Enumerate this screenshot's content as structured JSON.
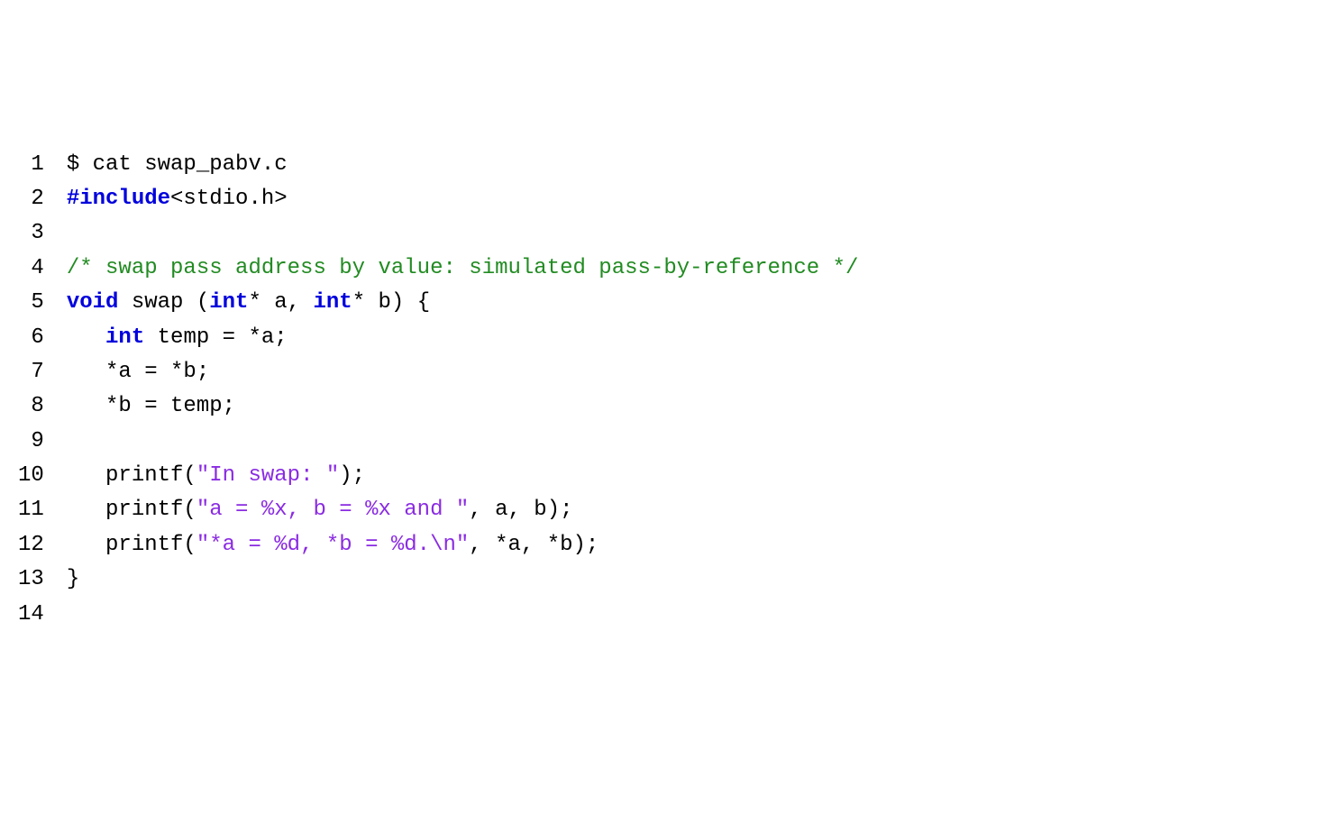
{
  "lines": [
    {
      "n": "1",
      "tokens": [
        {
          "cls": "black",
          "t": "$ cat swap_pabv.c"
        }
      ]
    },
    {
      "n": "2",
      "tokens": [
        {
          "cls": "preproc",
          "t": "#include"
        },
        {
          "cls": "black",
          "t": "<stdio.h>"
        }
      ]
    },
    {
      "n": "3",
      "tokens": []
    },
    {
      "n": "4",
      "tokens": [
        {
          "cls": "comment",
          "t": "/* swap pass address by value: simulated pass-by-reference */"
        }
      ]
    },
    {
      "n": "5",
      "tokens": [
        {
          "cls": "keyword",
          "t": "void"
        },
        {
          "cls": "black",
          "t": " swap ("
        },
        {
          "cls": "keyword",
          "t": "int"
        },
        {
          "cls": "black",
          "t": "* a, "
        },
        {
          "cls": "keyword",
          "t": "int"
        },
        {
          "cls": "black",
          "t": "* b) {"
        }
      ]
    },
    {
      "n": "6",
      "tokens": [
        {
          "cls": "black",
          "t": "   "
        },
        {
          "cls": "keyword",
          "t": "int"
        },
        {
          "cls": "black",
          "t": " temp = *a;"
        }
      ]
    },
    {
      "n": "7",
      "tokens": [
        {
          "cls": "black",
          "t": "   *a = *b;"
        }
      ]
    },
    {
      "n": "8",
      "tokens": [
        {
          "cls": "black",
          "t": "   *b = temp;"
        }
      ]
    },
    {
      "n": "9",
      "tokens": []
    },
    {
      "n": "10",
      "tokens": [
        {
          "cls": "black",
          "t": "   printf("
        },
        {
          "cls": "string",
          "t": "\"In swap: \""
        },
        {
          "cls": "black",
          "t": ");"
        }
      ]
    },
    {
      "n": "11",
      "tokens": [
        {
          "cls": "black",
          "t": "   printf("
        },
        {
          "cls": "string",
          "t": "\"a = %x, b = %x and \""
        },
        {
          "cls": "black",
          "t": ", a, b);"
        }
      ]
    },
    {
      "n": "12",
      "tokens": [
        {
          "cls": "black",
          "t": "   printf("
        },
        {
          "cls": "string",
          "t": "\"*a = %d, *b = %d.\\n\""
        },
        {
          "cls": "black",
          "t": ", *a, *b);"
        }
      ]
    },
    {
      "n": "13",
      "tokens": [
        {
          "cls": "black",
          "t": "}"
        }
      ]
    },
    {
      "n": "14",
      "tokens": []
    }
  ]
}
